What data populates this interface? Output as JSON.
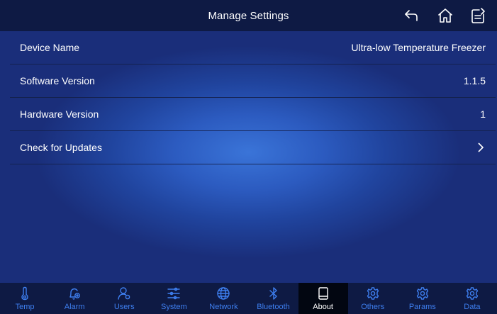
{
  "header": {
    "title": "Manage Settings",
    "back_icon": "back-arrow-icon",
    "home_icon": "home-icon",
    "notes_icon": "clipboard-edit-icon"
  },
  "rows": [
    {
      "label": "Device Name",
      "value": "Ultra-low Temperature Freezer"
    },
    {
      "label": "Software Version",
      "value": "1.1.5"
    },
    {
      "label": "Hardware Version",
      "value": "1"
    },
    {
      "label": "Check for Updates",
      "value": ""
    }
  ],
  "tabs": [
    {
      "label": "Temp",
      "icon": "thermometer-icon"
    },
    {
      "label": "Alarm",
      "icon": "alarm-bell-icon"
    },
    {
      "label": "Users",
      "icon": "users-icon"
    },
    {
      "label": "System",
      "icon": "sliders-icon"
    },
    {
      "label": "Network",
      "icon": "globe-icon"
    },
    {
      "label": "Bluetooth",
      "icon": "bluetooth-icon"
    },
    {
      "label": "About",
      "icon": "tablet-icon",
      "active": true
    },
    {
      "label": "Others",
      "icon": "gear-icon"
    },
    {
      "label": "Params",
      "icon": "gear-icon"
    },
    {
      "label": "Data",
      "icon": "gear-icon"
    }
  ],
  "colors": {
    "header_bg": "#0e1a44",
    "tab_inactive": "#3e7ff0",
    "tab_active_bg": "#020611"
  }
}
